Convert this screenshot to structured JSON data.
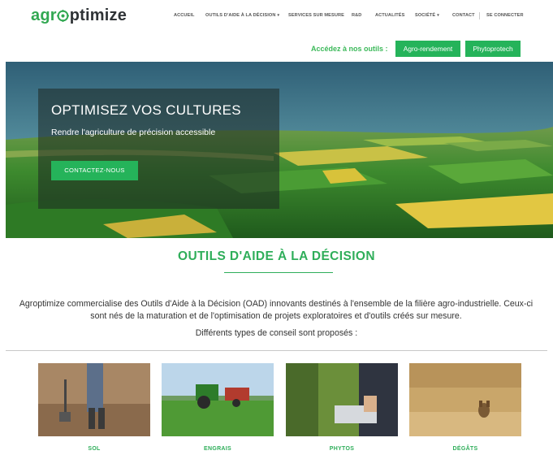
{
  "brand": {
    "logo_part1": "agr",
    "logo_part2": "ptimize"
  },
  "nav": {
    "items": [
      {
        "label": "ACCUEIL"
      },
      {
        "label": "OUTILS D'AIDE À LA DÉCISION",
        "caret": "▾"
      },
      {
        "label": "SERVICES SUR MESURE"
      },
      {
        "label": "R&D"
      },
      {
        "label": "ACTUALITÉS"
      },
      {
        "label": "SOCIÉTÉ",
        "caret": "▾"
      },
      {
        "label": "CONTACT"
      },
      {
        "label": "SE CONNECTER"
      }
    ]
  },
  "tools": {
    "label": "Accédez à nos outils :",
    "buttons": [
      {
        "label": "Agro-rendement"
      },
      {
        "label": "Phytoprotech"
      }
    ]
  },
  "hero": {
    "title": "OPTIMISEZ VOS CULTURES",
    "subtitle": "Rendre l'agriculture de précision accessible",
    "cta": "CONTACTEZ-NOUS"
  },
  "section": {
    "title": "OUTILS D'AIDE À LA DÉCISION",
    "intro": "Agroptimize commercialise des Outils d'Aide à la Décision (OAD) innovants destinés à l'ensemble de la filière agro-industrielle. Ceux-ci sont nés de la maturation et de l'optimisation de projets exploratoires et d'outils créés sur mesure.",
    "intro_2": "Différents types de conseil sont proposés :"
  },
  "cards": [
    {
      "label": "SOL"
    },
    {
      "label": "ENGRAIS"
    },
    {
      "label": "PHYTOS"
    },
    {
      "label": "DÉGÂTS"
    }
  ],
  "colors": {
    "brand_green": "#25b35a",
    "title_green": "#2fae5a",
    "logo_dark": "#2f3336"
  }
}
